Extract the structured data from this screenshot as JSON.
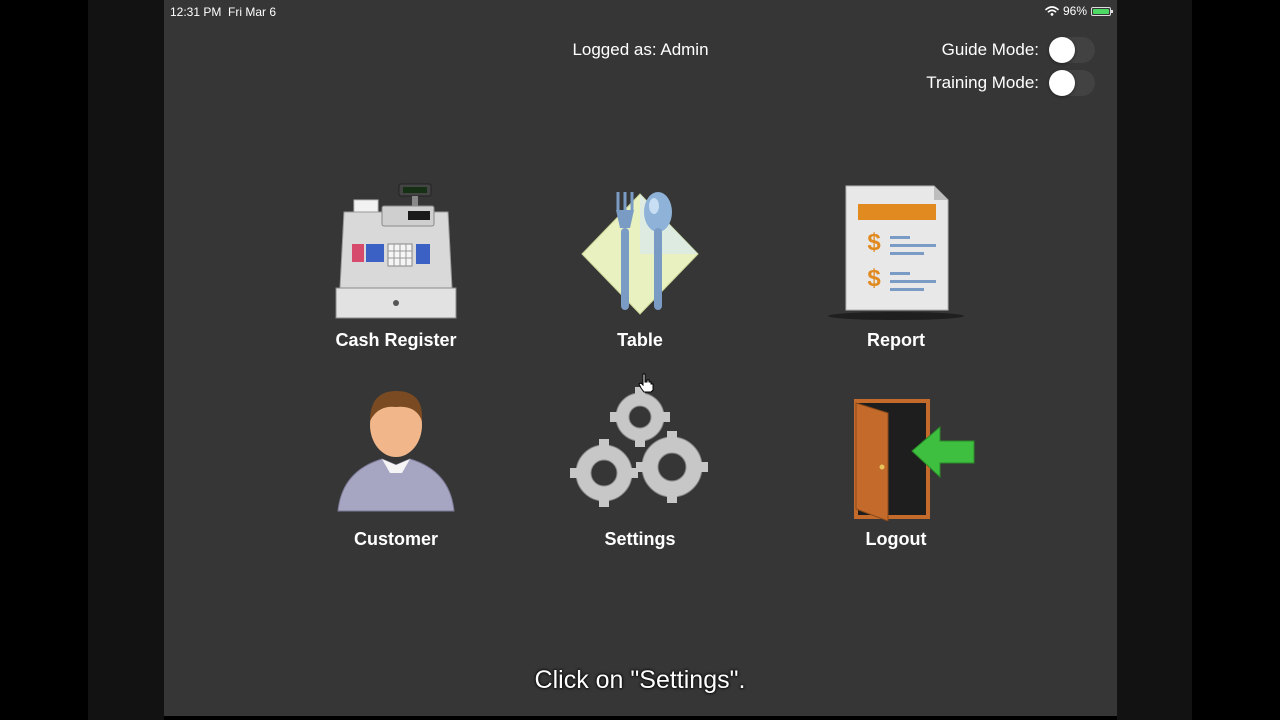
{
  "status_bar": {
    "time": "12:31 PM",
    "date": "Fri Mar 6",
    "battery": "96%"
  },
  "header": {
    "logged_as": "Logged as: Admin"
  },
  "modes": {
    "guide_label": "Guide Mode:",
    "guide_on": false,
    "training_label": "Training Mode:",
    "training_on": false
  },
  "menu": {
    "cash_register": "Cash Register",
    "table": "Table",
    "report": "Report",
    "customer": "Customer",
    "settings": "Settings",
    "logout": "Logout"
  },
  "caption": "Click on \"Settings\".",
  "colors": {
    "background": "#363636",
    "text": "#ffffff",
    "battery_fill": "#4cd964"
  }
}
